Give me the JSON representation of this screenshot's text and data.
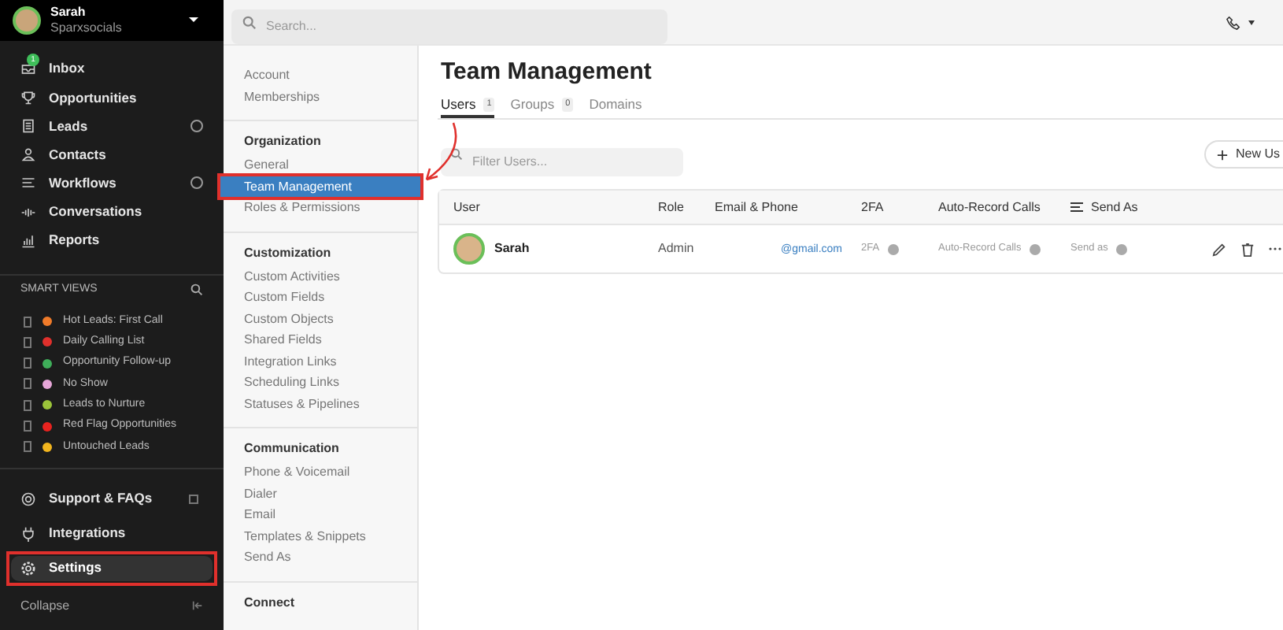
{
  "account": {
    "name": "Sarah",
    "org": "Sparxsocials"
  },
  "nav": [
    {
      "label": "Inbox",
      "badge": "1",
      "expandable": false
    },
    {
      "label": "Opportunities",
      "expandable": false
    },
    {
      "label": "Leads",
      "expandable": true
    },
    {
      "label": "Contacts",
      "expandable": false
    },
    {
      "label": "Workflows",
      "expandable": true
    },
    {
      "label": "Conversations",
      "expandable": false
    },
    {
      "label": "Reports",
      "expandable": false
    }
  ],
  "smart_views": {
    "title": "SMART VIEWS",
    "items": [
      {
        "label": "Hot Leads: First Call",
        "color": "#f07b2a"
      },
      {
        "label": "Daily Calling List",
        "color": "#e0302c"
      },
      {
        "label": "Opportunity Follow-up",
        "color": "#3fae5a"
      },
      {
        "label": "No Show",
        "color": "#e6a6d8"
      },
      {
        "label": "Leads to Nurture",
        "color": "#9bc43a"
      },
      {
        "label": "Red Flag Opportunities",
        "color": "#e8231f"
      },
      {
        "label": "Untouched Leads",
        "color": "#f2b51e"
      }
    ]
  },
  "bottom_nav": [
    {
      "label": "Support & FAQs",
      "external": true,
      "selected": false,
      "highlighted": false
    },
    {
      "label": "Integrations",
      "external": false,
      "selected": false,
      "highlighted": false
    },
    {
      "label": "Settings",
      "external": false,
      "selected": true,
      "highlighted": true
    }
  ],
  "collapse": "Collapse",
  "search": {
    "placeholder": "Search..."
  },
  "settings_nav": [
    {
      "items": [
        {
          "label": "Account",
          "selected": false,
          "highlighted": false
        },
        {
          "label": "Memberships",
          "selected": false,
          "highlighted": false
        }
      ]
    },
    {
      "title": "Organization",
      "items": [
        {
          "label": "General",
          "selected": false,
          "highlighted": false
        },
        {
          "label": "Team Management",
          "selected": true,
          "highlighted": true
        },
        {
          "label": "Roles & Permissions",
          "selected": false,
          "highlighted": false
        }
      ]
    },
    {
      "title": "Customization",
      "items": [
        {
          "label": "Custom Activities",
          "selected": false,
          "highlighted": false
        },
        {
          "label": "Custom Fields",
          "selected": false,
          "highlighted": false
        },
        {
          "label": "Custom Objects",
          "selected": false,
          "highlighted": false
        },
        {
          "label": "Shared Fields",
          "selected": false,
          "highlighted": false
        },
        {
          "label": "Integration Links",
          "selected": false,
          "highlighted": false
        },
        {
          "label": "Scheduling Links",
          "selected": false,
          "highlighted": false
        },
        {
          "label": "Statuses & Pipelines",
          "selected": false,
          "highlighted": false
        }
      ]
    },
    {
      "title": "Communication",
      "items": [
        {
          "label": "Phone & Voicemail",
          "selected": false,
          "highlighted": false
        },
        {
          "label": "Dialer",
          "selected": false,
          "highlighted": false
        },
        {
          "label": "Email",
          "selected": false,
          "highlighted": false
        },
        {
          "label": "Templates & Snippets",
          "selected": false,
          "highlighted": false
        },
        {
          "label": "Send As",
          "selected": false,
          "highlighted": false
        }
      ]
    },
    {
      "title": "Connect"
    }
  ],
  "page": {
    "title": "Team Management",
    "tabs": [
      {
        "label": "Users",
        "count": "1",
        "selected": true
      },
      {
        "label": "Groups",
        "count": "0",
        "selected": false
      },
      {
        "label": "Domains",
        "selected": false
      }
    ],
    "filter": {
      "placeholder": "Filter Users..."
    },
    "new_button": "New Us",
    "table": {
      "columns": [
        "User",
        "Role",
        "Email & Phone",
        "2FA",
        "Auto-Record Calls",
        "Send As"
      ],
      "rows": [
        {
          "user": "Sarah",
          "role": "Admin",
          "email": "@gmail.com",
          "two_fa": "2FA",
          "auto_record": "Auto-Record Calls",
          "send_as": "Send as"
        }
      ]
    }
  }
}
